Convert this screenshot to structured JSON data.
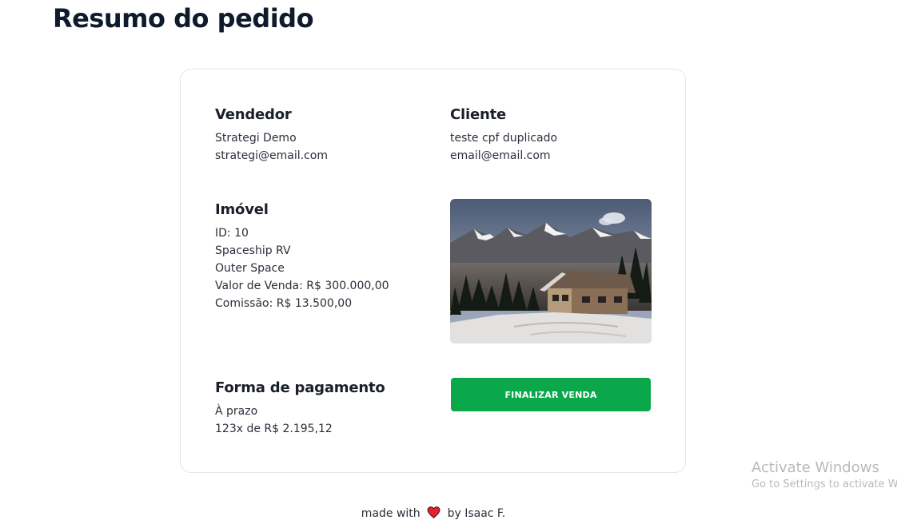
{
  "page": {
    "title": "Resumo do pedido"
  },
  "vendedor": {
    "heading": "Vendedor",
    "name": "Strategi Demo",
    "email": "strategi@email.com"
  },
  "cliente": {
    "heading": "Cliente",
    "name": "teste cpf duplicado",
    "email": "email@email.com"
  },
  "imovel": {
    "heading": "Imóvel",
    "id": "ID: 10",
    "name": "Spaceship RV",
    "location": "Outer Space",
    "valor_venda": "Valor de Venda: R$ 300.000,00",
    "comissao": "Comissão: R$ 13.500,00",
    "photo_icon": "mountain-cabin-photo"
  },
  "pagamento": {
    "heading": "Forma de pagamento",
    "type": "À prazo",
    "installments": "123x de R$ 2.195,12"
  },
  "actions": {
    "finalize_label": "FINALIZAR VENDA",
    "finalize_color": "#0aa84a"
  },
  "footer": {
    "prefix": "made with",
    "suffix": "by Isaac F.",
    "heart_icon": "heart-icon",
    "heart_color": "#e0242f"
  },
  "watermark": {
    "title": "Activate Windows",
    "subtitle": "Go to Settings to activate Windows."
  }
}
